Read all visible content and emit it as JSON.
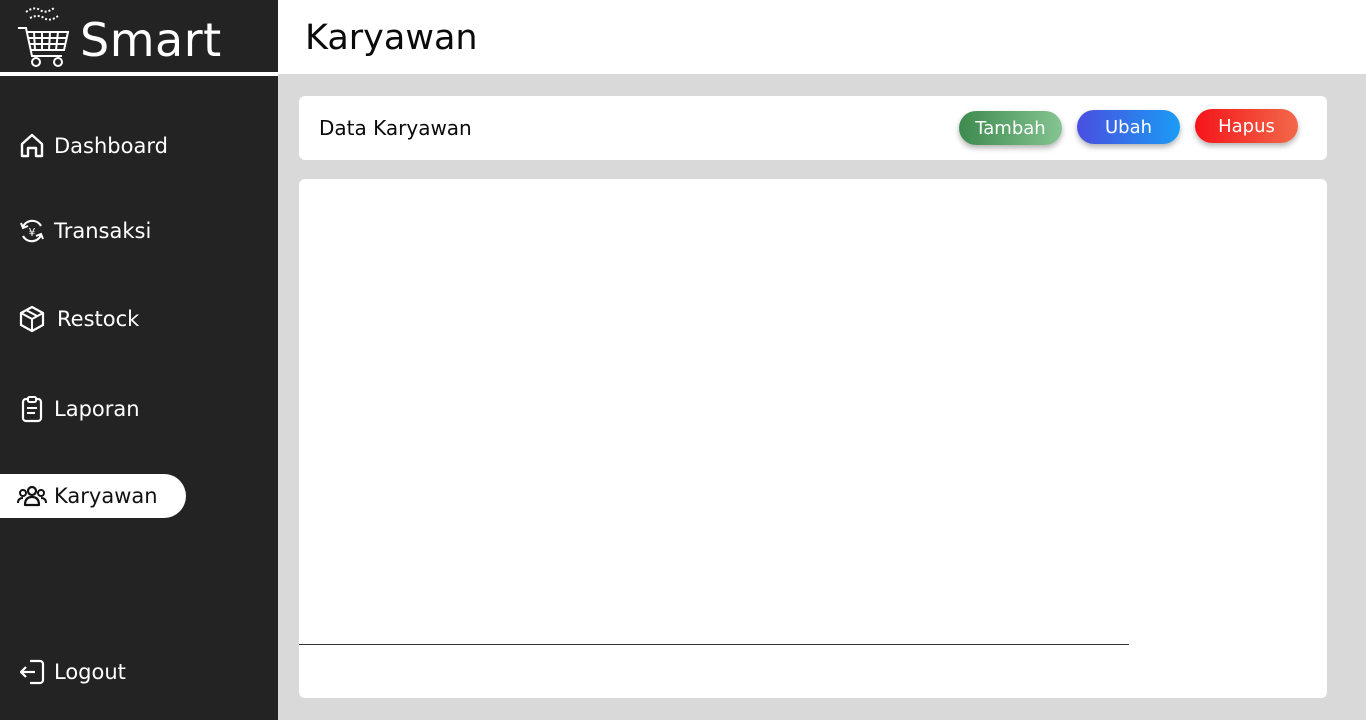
{
  "brand": {
    "name": "Smart",
    "logo_icon": "shopping-cart-icon"
  },
  "sidebar": {
    "items": [
      {
        "label": "Dashboard",
        "icon": "home-icon",
        "active": false
      },
      {
        "label": "Transaksi",
        "icon": "currency-exchange-icon",
        "active": false
      },
      {
        "label": "Restock",
        "icon": "box-icon",
        "active": false
      },
      {
        "label": "Laporan",
        "icon": "clipboard-icon",
        "active": false
      },
      {
        "label": "Karyawan",
        "icon": "users-icon",
        "active": true
      }
    ],
    "logout": {
      "label": "Logout",
      "icon": "logout-icon"
    }
  },
  "header": {
    "title": "Karyawan"
  },
  "toolbar": {
    "title": "Data Karyawan",
    "buttons": {
      "tambah": "Tambah",
      "ubah": "Ubah",
      "hapus": "Hapus"
    }
  },
  "colors": {
    "sidebar_bg": "#232323",
    "page_bg": "#d9d9d9",
    "tambah": "#3d8a4e",
    "ubah": "#4a4fe0",
    "hapus": "#f5141a"
  }
}
